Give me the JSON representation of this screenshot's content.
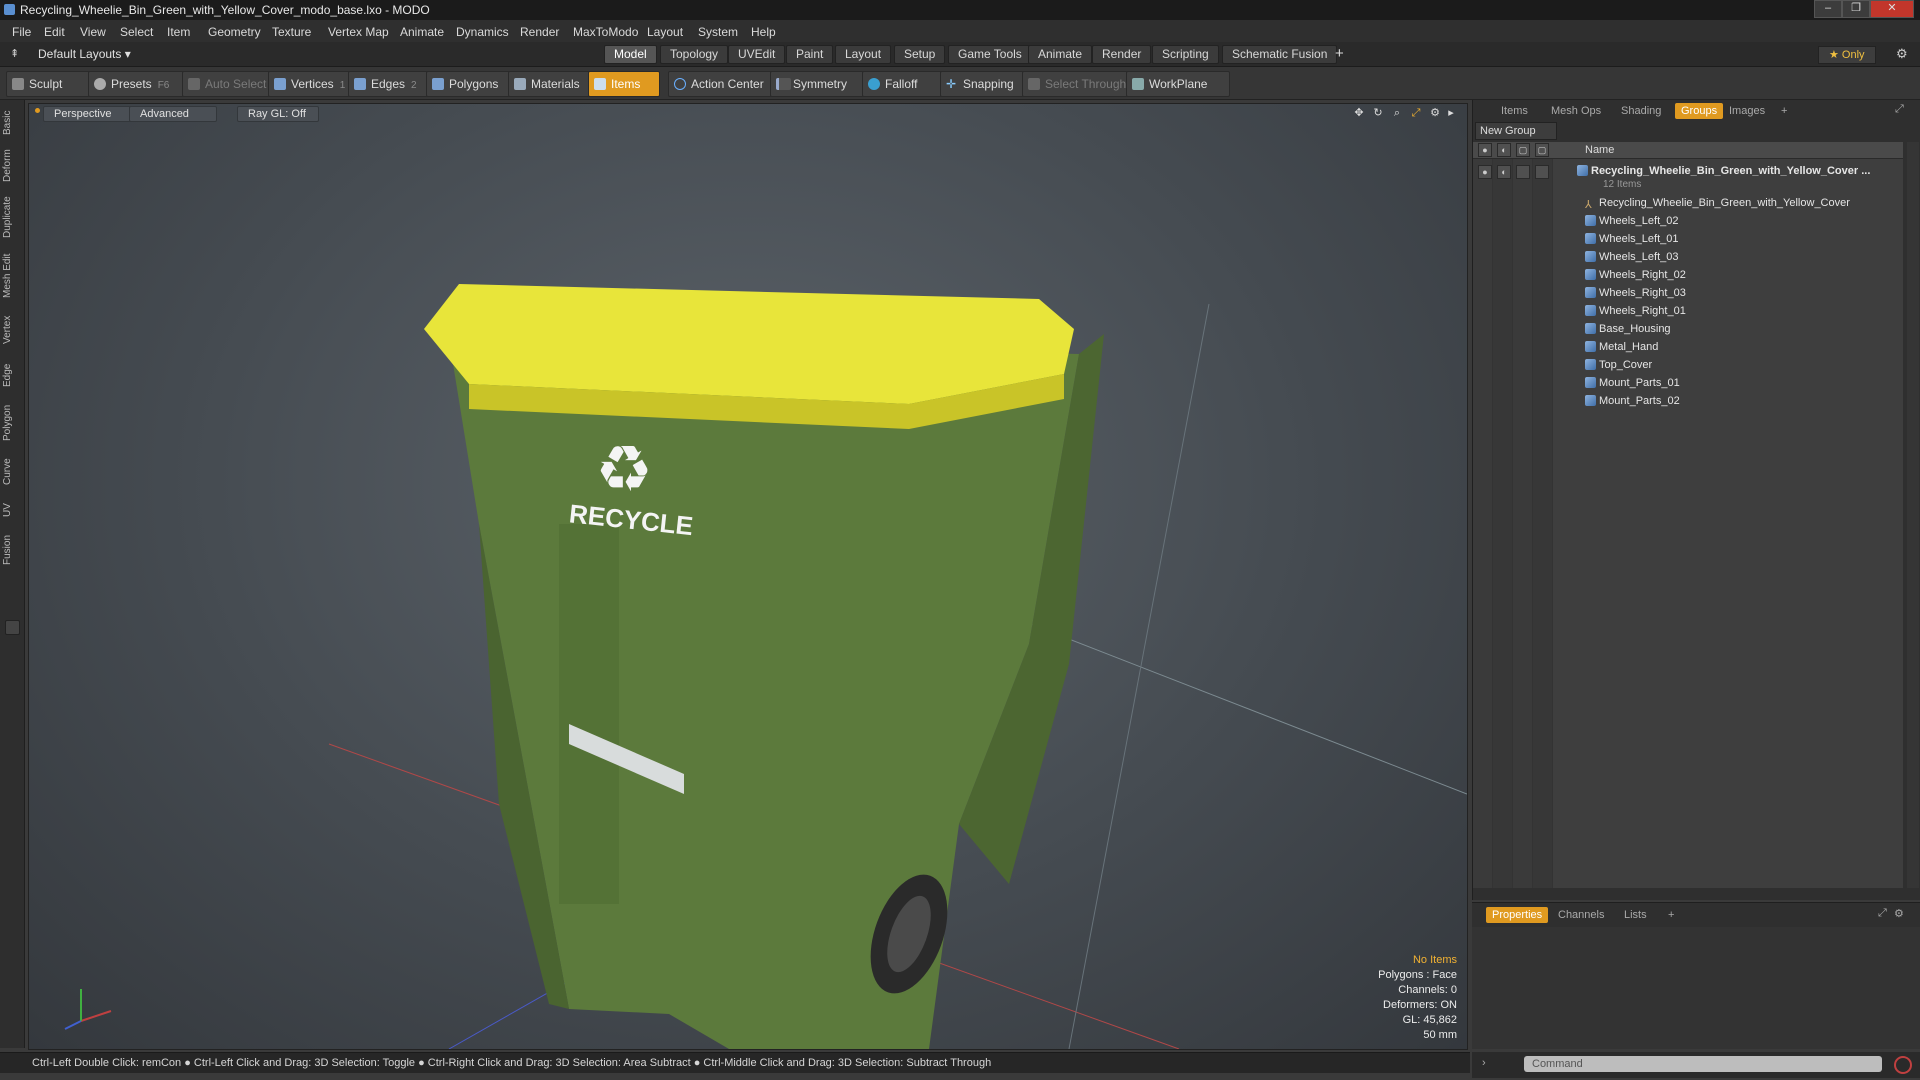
{
  "window": {
    "title": "Recycling_Wheelie_Bin_Green_with_Yellow_Cover_modo_base.lxo - MODO",
    "controls": [
      "–",
      "❐",
      "✕"
    ]
  },
  "menubar": [
    "File",
    "Edit",
    "View",
    "Select",
    "Item",
    "Geometry",
    "Texture",
    "Vertex Map",
    "Animate",
    "Dynamics",
    "Render",
    "MaxToModo",
    "Layout",
    "System",
    "Help"
  ],
  "layouts": {
    "label": "Default Layouts ▾"
  },
  "tabs": [
    "Model",
    "Topology",
    "UVEdit",
    "Paint",
    "Layout",
    "Setup",
    "Game Tools",
    "Animate",
    "Render",
    "Scripting",
    "Schematic Fusion"
  ],
  "tabs_add": "+",
  "only_label": "★ Only",
  "toolbar": {
    "sculpt": "Sculpt",
    "presets": "Presets",
    "presets_key": "F6",
    "auto_select": "Auto Select",
    "vertices": "Vertices",
    "vertices_count": "1",
    "edges": "Edges",
    "edges_count": "2",
    "polygons": "Polygons",
    "materials": "Materials",
    "items": "Items",
    "action_center": "Action Center",
    "symmetry": "Symmetry",
    "falloff": "Falloff",
    "snapping": "Snapping",
    "select_through": "Select Through",
    "workplane": "WorkPlane"
  },
  "left_tabs": [
    "Basic",
    "Deform",
    "Duplicate",
    "Mesh Edit",
    "Vertex",
    "Edge",
    "Polygon",
    "Curve",
    "UV",
    "Fusion"
  ],
  "viewport": {
    "perspective": "Perspective",
    "advanced": "Advanced",
    "raygl": "Ray GL: Off",
    "decal_text": "RECYCLE",
    "info": {
      "items": "No Items",
      "polygons": "Polygons : Face",
      "channels": "Channels: 0",
      "deformers": "Deformers: ON",
      "gl": "GL: 45,862",
      "scale": "50 mm"
    }
  },
  "right_panel": {
    "tabs": [
      "Items",
      "Mesh Ops",
      "Shading",
      "Groups",
      "Images"
    ],
    "active_tab": "Groups",
    "add": "+",
    "new_group": "New Group",
    "name_header": "Name",
    "group_name": "Recycling_Wheelie_Bin_Green_with_Yellow_Cover ...",
    "group_count": "12 Items",
    "items": [
      {
        "label": "Recycling_Wheelie_Bin_Green_with_Yellow_Cover",
        "icon": "locator-icon"
      },
      {
        "label": "Wheels_Left_02",
        "icon": "mesh-icon"
      },
      {
        "label": "Wheels_Left_01",
        "icon": "mesh-icon"
      },
      {
        "label": "Wheels_Left_03",
        "icon": "mesh-icon"
      },
      {
        "label": "Wheels_Right_02",
        "icon": "mesh-icon"
      },
      {
        "label": "Wheels_Right_03",
        "icon": "mesh-icon"
      },
      {
        "label": "Wheels_Right_01",
        "icon": "mesh-icon"
      },
      {
        "label": "Base_Housing",
        "icon": "mesh-icon"
      },
      {
        "label": "Metal_Hand",
        "icon": "mesh-icon"
      },
      {
        "label": "Top_Cover",
        "icon": "mesh-icon"
      },
      {
        "label": "Mount_Parts_01",
        "icon": "mesh-icon"
      },
      {
        "label": "Mount_Parts_02",
        "icon": "mesh-icon"
      }
    ]
  },
  "properties_panel": {
    "tabs": [
      "Properties",
      "Channels",
      "Lists"
    ],
    "add": "+"
  },
  "statusbar": "Ctrl-Left Double Click: remCon ● Ctrl-Left Click and Drag: 3D Selection: Toggle ● Ctrl-Right Click and Drag: 3D Selection: Area Subtract ● Ctrl-Middle Click and Drag: 3D Selection: Subtract Through",
  "command": {
    "placeholder": "Command"
  },
  "colors": {
    "accent": "#e09a20",
    "bin_green": "#5c7a3c",
    "lid_yellow": "#e8e53a"
  }
}
